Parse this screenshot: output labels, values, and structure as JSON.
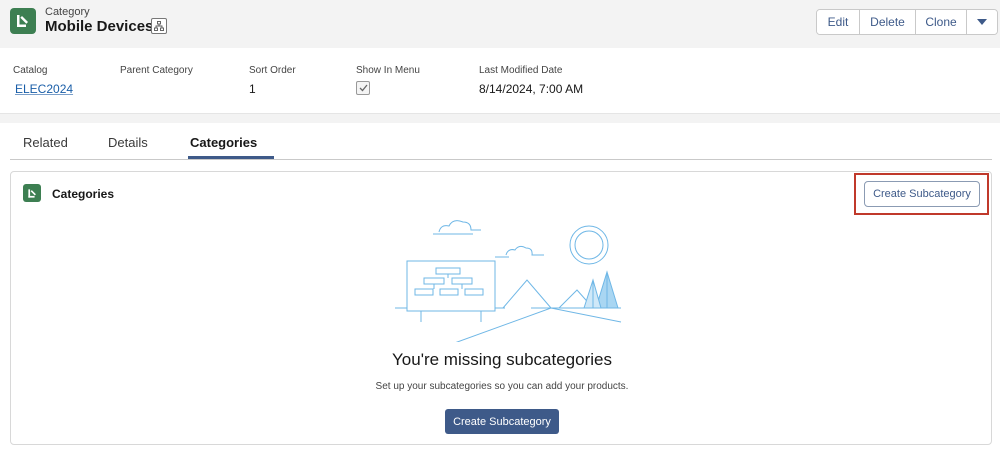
{
  "header": {
    "object_label": "Category",
    "record_title": "Mobile Devices",
    "actions": {
      "edit": "Edit",
      "delete": "Delete",
      "clone": "Clone"
    }
  },
  "highlights": {
    "catalog": {
      "label": "Catalog",
      "value": "ELEC2024"
    },
    "parent_category": {
      "label": "Parent Category",
      "value": ""
    },
    "sort_order": {
      "label": "Sort Order",
      "value": "1"
    },
    "show_in_menu": {
      "label": "Show In Menu",
      "checked": true
    },
    "last_modified": {
      "label": "Last Modified Date",
      "value": "8/14/2024, 7:00 AM"
    }
  },
  "tabs": [
    {
      "label": "Related",
      "active": false
    },
    {
      "label": "Details",
      "active": false
    },
    {
      "label": "Categories",
      "active": true
    }
  ],
  "card": {
    "title": "Categories",
    "header_button": "Create Subcategory",
    "empty_title": "You're missing subcategories",
    "empty_subtitle": "Set up your subcategories so you can add your products.",
    "empty_button": "Create Subcategory"
  },
  "colors": {
    "brand_blue": "#3e5a89",
    "object_icon_green": "#3d7f52",
    "highlight_red": "#c0392b",
    "illustration_blue": "#6fb7e6"
  }
}
